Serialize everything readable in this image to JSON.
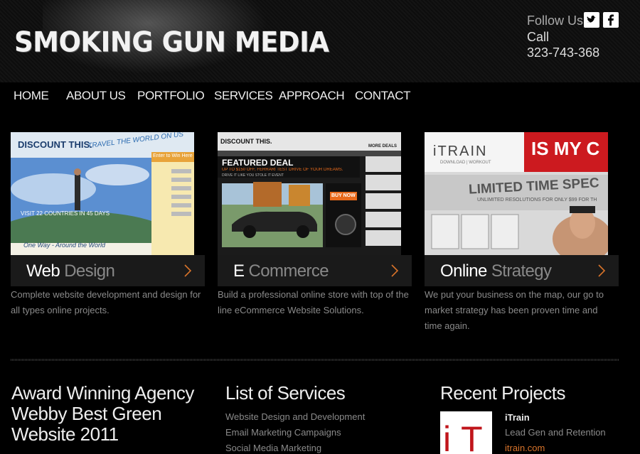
{
  "header": {
    "logo": "SMOKING GUN MEDIA",
    "follow_label": "Follow Us:",
    "call_label": "Call",
    "phone": "323-743-368",
    "social_twitter": "twitter-icon",
    "social_facebook": "facebook-icon"
  },
  "nav": [
    "HOME",
    "ABOUT US",
    "PORTFOLIO",
    "SERVICES",
    "APPROACH",
    "CONTACT"
  ],
  "cards": [
    {
      "title_a": "Web",
      "title_b": " Design",
      "desc": "Complete website development and design for all types online projects."
    },
    {
      "title_a": "E",
      "title_b": " Commerce",
      "desc": "Build a professional online store with top of the line eCommerce Website Solutions."
    },
    {
      "title_a": "Online",
      "title_b": " Strategy",
      "desc": "We put your business on the map, our go to market strategy has been proven time and time again."
    }
  ],
  "thumbs": {
    "web": {
      "brand": "DISCOUNT THIS.",
      "tagline": "TRAVEL THE WORLD ON US",
      "banner": "VISIT 22 COUNTRIES IN 45 DAYS",
      "footer": "One Way - Around the World",
      "form_title": "Enter to Win Here"
    },
    "ecom": {
      "brand": "DISCOUNT THIS.",
      "headline": "FEATURED DEAL",
      "deal": "UP TO $150 OFF, FERRARI TEST DRIVE OF YOUR DREAMS.",
      "sub": "DRIVE IT LIKE YOU STOLE IT EVENT",
      "buy": "BUY NOW",
      "more": "MORE DEALS"
    },
    "strategy": {
      "brand": "iTRAIN",
      "brand_sub": "DOWNLOAD | WORKOUT",
      "red": "IS MY C",
      "promo": "LIMITED TIME SPEC",
      "promo_sub": "UNLIMITED RESOLUTIONS FOR ONLY $99 FOR TH"
    }
  },
  "bottom": {
    "award": "Award Winning Agency Webby Best Green Website 2011",
    "services_title": "List of Services",
    "services": [
      "Website Design and Development",
      "Email Marketing Campaigns",
      "Social Media Marketing"
    ],
    "projects_title": "Recent Projects",
    "project_name": "iTrain",
    "project_desc": "Lead Gen and Retention",
    "project_link": "itrain.com",
    "project_thumb_text": "iT"
  }
}
